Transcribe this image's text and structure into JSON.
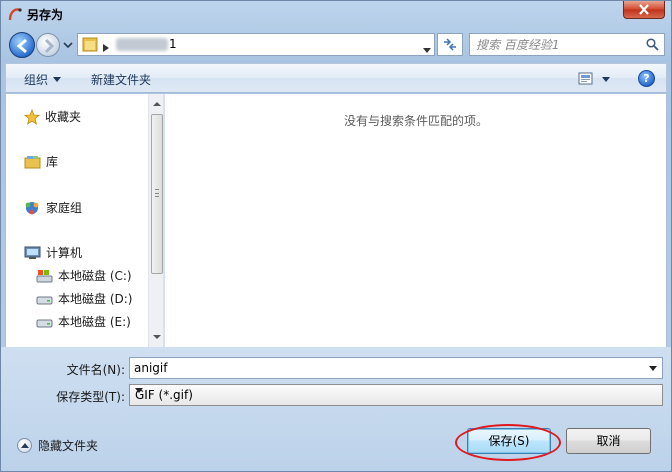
{
  "window": {
    "title": "另存为",
    "accent": "#d2472b"
  },
  "navbar": {
    "address_text": "1",
    "search_placeholder": "搜索 百度经验1"
  },
  "toolbar": {
    "organize_label": "组织",
    "new_folder_label": "新建文件夹",
    "help_label": "?"
  },
  "nav_pane": {
    "favorites": "收藏夹",
    "libraries": "库",
    "homegroup": "家庭组",
    "computer": "计算机",
    "drives": [
      {
        "label": "本地磁盘 (C:)",
        "icon": "system-drive-icon"
      },
      {
        "label": "本地磁盘 (D:)",
        "icon": "drive-icon"
      },
      {
        "label": "本地磁盘 (E:)",
        "icon": "drive-icon"
      }
    ]
  },
  "content": {
    "empty_message": "没有与搜索条件匹配的项。"
  },
  "form": {
    "filename_label": "文件名(N):",
    "filename_value": "anigif",
    "filetype_label": "保存类型(T):",
    "filetype_value": "GIF (*.gif)"
  },
  "footer": {
    "hide_folders_label": "隐藏文件夹",
    "save_label": "保存(S)",
    "cancel_label": "取消",
    "highlight_color": "#e0191f"
  }
}
